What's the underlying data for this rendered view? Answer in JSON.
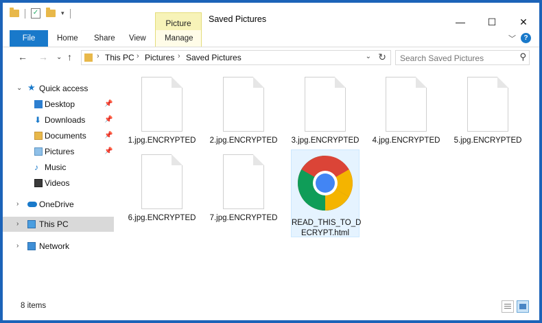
{
  "window": {
    "title": "Saved Pictures",
    "context_tab": "Picture Tools",
    "buttons": {
      "minimize": "—",
      "maximize": "☐",
      "close": "✕"
    }
  },
  "ribbon": {
    "tabs": [
      "File",
      "Home",
      "Share",
      "View",
      "Manage"
    ]
  },
  "address": {
    "crumbs": [
      "This PC",
      "Pictures",
      "Saved Pictures"
    ]
  },
  "search": {
    "placeholder": "Search Saved Pictures"
  },
  "nav": {
    "quick_access": "Quick access",
    "pinned": [
      "Desktop",
      "Downloads",
      "Documents",
      "Pictures"
    ],
    "unpinned": [
      "Music",
      "Videos"
    ],
    "onedrive": "OneDrive",
    "this_pc": "This PC",
    "network": "Network"
  },
  "files": [
    "1.jpg.ENCRYPTED",
    "2.jpg.ENCRYPTED",
    "3.jpg.ENCRYPTED",
    "4.jpg.ENCRYPTED",
    "5.jpg.ENCRYPTED",
    "6.jpg.ENCRYPTED",
    "7.jpg.ENCRYPTED",
    "READ_THIS_TO_DECRYPT.html"
  ],
  "html_file_label_line1": "READ_THIS_TO_D",
  "html_file_label_line2": "ECRYPT.html",
  "status": {
    "count": "8 items"
  },
  "colors": {
    "accent": "#1979ca",
    "frame": "#1c63b8",
    "context_tab_bg": "#f7f3b8",
    "selection": "#e5f3ff"
  }
}
